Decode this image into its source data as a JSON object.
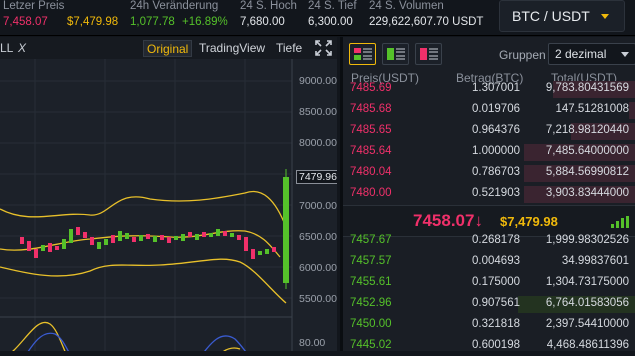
{
  "stats": [
    {
      "label": "Letzer Preis",
      "value": "7,458.07",
      "value2": "$7,479.98"
    },
    {
      "label": "24h Veränderung",
      "value": "1,077.78",
      "value2": "+16.89%"
    },
    {
      "label": "24 S. Hoch",
      "value": "7,680.00"
    },
    {
      "label": "24 S. Tief",
      "value": "6,300.00"
    },
    {
      "label": "24 S. Volumen",
      "value": "229,622,607.70 USDT"
    }
  ],
  "pair": "BTC / USDT",
  "chart_toolbar": {
    "left1": "LL",
    "left2": "X",
    "original": "Original",
    "tradingview": "TradingView",
    "tiefe": "Tiefe"
  },
  "chart": {
    "y_labels": [
      "9000.00",
      "8500.00",
      "8000.00",
      "7000.00",
      "6500.00",
      "6000.00",
      "5500.00",
      "80.00"
    ],
    "current_price": "7479.96"
  },
  "orderbook": {
    "gruppen_label": "Gruppen",
    "decimal": "2 dezimal",
    "headers": {
      "price": "Preis(USDT)",
      "amount": "Betrag(BTC)",
      "total": "Total(USDT)"
    },
    "asks": [
      {
        "price": "7485.69",
        "amount": "1.307001",
        "total": "9,783.80431569",
        "depth": 0.28
      },
      {
        "price": "7485.68",
        "amount": "0.019706",
        "total": "147.51281008",
        "depth": 0.02
      },
      {
        "price": "7485.65",
        "amount": "0.964376",
        "total": "7,218.98120440",
        "depth": 0.22
      },
      {
        "price": "7485.64",
        "amount": "1.000000",
        "total": "7,485.64000000",
        "depth": 0.38
      },
      {
        "price": "7480.04",
        "amount": "0.786703",
        "total": "5,884.56990812",
        "depth": 0.38
      },
      {
        "price": "7480.00",
        "amount": "0.521903",
        "total": "3,903.83444000",
        "depth": 0.38
      }
    ],
    "last_price": "7458.07",
    "last_arrow": "↓",
    "last_usd": "$7,479.98",
    "bids": [
      {
        "price": "7457.67",
        "amount": "0.268178",
        "total": "1,999.98302526",
        "depth": 0.0
      },
      {
        "price": "7457.57",
        "amount": "0.004693",
        "total": "34.99837601",
        "depth": 0.0
      },
      {
        "price": "7455.61",
        "amount": "0.175000",
        "total": "1,304.73175000",
        "depth": 0.0
      },
      {
        "price": "7452.96",
        "amount": "0.907561",
        "total": "6,764.01583056",
        "depth": 0.4
      },
      {
        "price": "7450.00",
        "amount": "0.321818",
        "total": "2,397.54410000",
        "depth": 0.0
      },
      {
        "price": "7445.02",
        "amount": "0.600198",
        "total": "4,468.48611396",
        "depth": 0.0
      }
    ]
  },
  "colors": {
    "up": "#55c12a",
    "down": "#f0306a",
    "accent": "#f0b90b"
  }
}
